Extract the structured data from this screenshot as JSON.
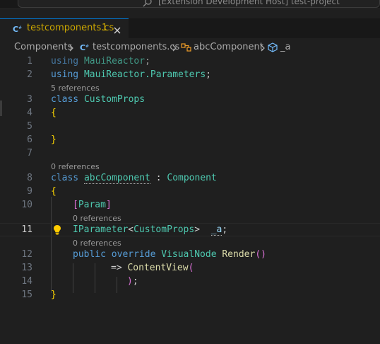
{
  "window": {
    "command_center_text": "[Extension Development Host] test-project"
  },
  "tab": {
    "label": "testcomponents.cs",
    "badge": "1"
  },
  "breadcrumb": {
    "folder": "Components",
    "file": "testcomponents.cs",
    "class": "abcComponent",
    "member": "_a"
  },
  "editor": {
    "line_numbers": [
      "1",
      "2",
      "3",
      "4",
      "5",
      "6",
      "7",
      "8",
      "9",
      "10",
      "11",
      "12",
      "13",
      "14",
      "15"
    ],
    "code_lens": {
      "custom_props_refs": "5 references",
      "abc_component_refs": "0 references",
      "param_refs": "0 references",
      "render_refs": "0 references"
    },
    "tokens": {
      "using": "using",
      "ns_mauireactor": "MauiReactor",
      "ns_mauireactor_params": "MauiReactor.Parameters",
      "semicolon": ";",
      "class_kw": "class",
      "custom_props": "CustomProps",
      "open_brace": "{",
      "close_brace": "}",
      "abc_component": "abcComponent",
      "colon": " : ",
      "component": "Component",
      "attr_open": "[",
      "param": "Param",
      "attr_close": "]",
      "iparameter": "IParameter",
      "lt": "<",
      "gt": ">",
      "field_name": "_a",
      "public_kw": "public",
      "override_kw": "override",
      "visual_node": "VisualNode",
      "render": "Render",
      "parens": "()",
      "arrow": "=>",
      "content_view": "ContentView",
      "open_paren": "(",
      "close_paren": ")"
    }
  },
  "colors": {
    "background": "#1f1f1f",
    "tab_modified": "#cca700",
    "keyword": "#569cd6",
    "type": "#4ec9b0",
    "function": "#dcdcaa"
  }
}
